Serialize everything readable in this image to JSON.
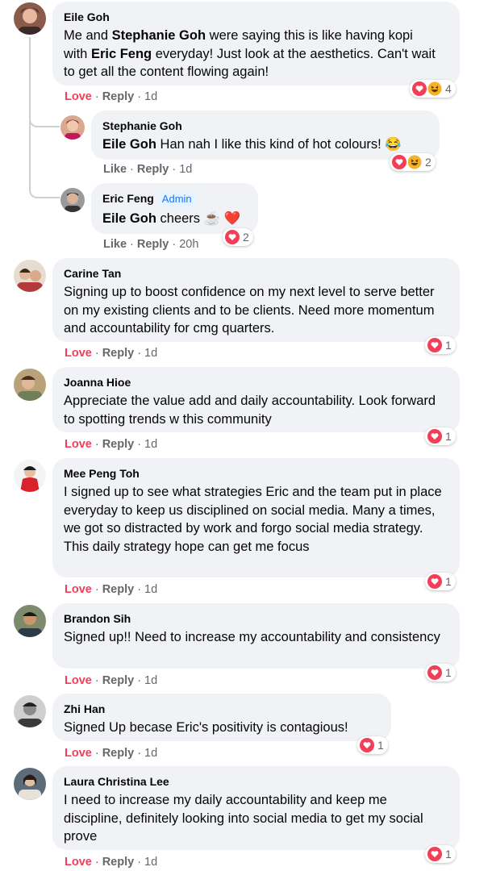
{
  "comments": [
    {
      "name": "Eile Goh",
      "text_parts": [
        "Me and ",
        "Stephanie Goh",
        " were saying this is like having kopi ",
        "with ",
        "Eric Feng",
        " everyday! Just look at the aesthetics. Can't wait to get all the content flowing again!"
      ],
      "action": "Love",
      "reply": "Reply",
      "time": "1d",
      "reactions": "4"
    },
    {
      "name": "Stephanie Goh",
      "mention": "Eile Goh",
      "text": " Han nah I like this kind of hot colours! 😂",
      "action": "Like",
      "reply": "Reply",
      "time": "1d",
      "reactions": "2"
    },
    {
      "name": "Eric Feng",
      "badge": "Admin",
      "mention": "Eile Goh",
      "text": " cheers ☕ ❤️",
      "action": "Like",
      "reply": "Reply",
      "time": "20h",
      "reactions": "2"
    },
    {
      "name": "Carine Tan",
      "text": "Signing up to boost confidence on my next level to serve better on my existing clients and to be clients. Need more momentum and accountability for cmg quarters.",
      "action": "Love",
      "reply": "Reply",
      "time": "1d",
      "reactions": "1"
    },
    {
      "name": "Joanna Hioe",
      "text": "Appreciate the value add and daily accountability. Look forward to spotting trends w this community",
      "action": "Love",
      "reply": "Reply",
      "time": "1d",
      "reactions": "1"
    },
    {
      "name": "Mee Peng Toh",
      "text": "I signed up to see what strategies Eric and the team put in place everyday to keep us disciplined on social media. Many a times, we got so distracted by work and forgo social media strategy. This daily strategy hope can get me focus",
      "action": "Love",
      "reply": "Reply",
      "time": "1d",
      "reactions": "1"
    },
    {
      "name": "Brandon Sih",
      "text": "Signed up!! Need to increase my accountability and consistency",
      "action": "Love",
      "reply": "Reply",
      "time": "1d",
      "reactions": "1"
    },
    {
      "name": "Zhi Han",
      "text": "Signed Up becase Eric's positivity is contagious!",
      "action": "Love",
      "reply": "Reply",
      "time": "1d",
      "reactions": "1"
    },
    {
      "name": "Laura Christina Lee",
      "text": "I need to increase my daily accountability and keep me discipline, definitely looking into social media to get my social prove",
      "action": "Love",
      "reply": "Reply",
      "time": "1d",
      "reactions": "1"
    }
  ],
  "separator": "·",
  "icons": {
    "love": "heart-reaction-icon",
    "haha": "laughing-reaction-icon"
  },
  "colors": {
    "bubble": "#f0f2f5",
    "love_red": "#f33e58",
    "meta_gray": "#65676b",
    "admin_blue": "#1877f2"
  }
}
